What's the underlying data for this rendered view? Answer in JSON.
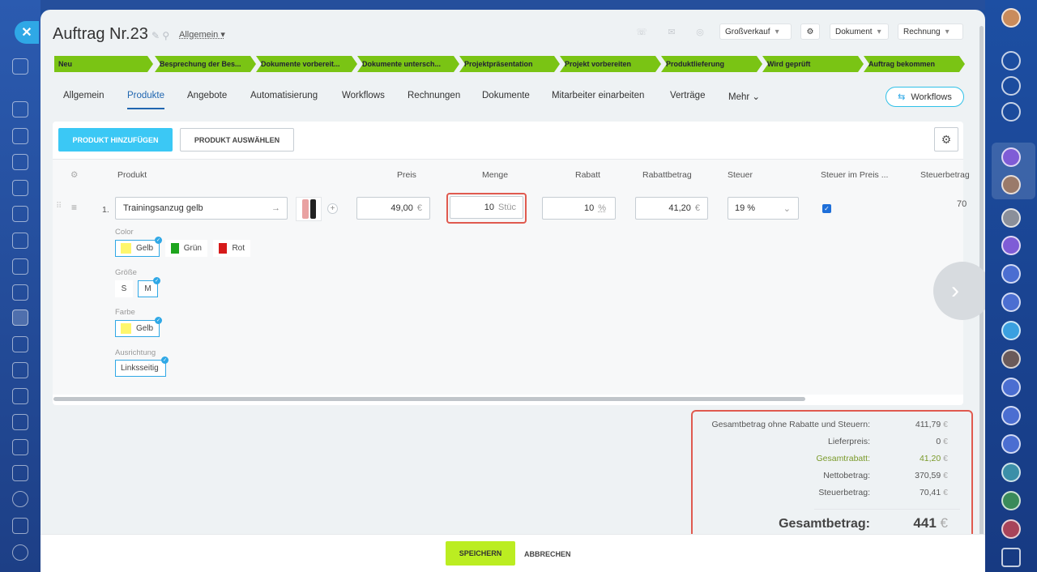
{
  "order": {
    "title": "Auftrag Nr.23",
    "category": "Allgemein"
  },
  "header": {
    "segment": "Großverkauf",
    "document": "Dokument",
    "invoice": "Rechnung"
  },
  "stages": [
    "Neu",
    "Besprechung der Bes...",
    "Dokumente vorbereit...",
    "Dokumente untersch...",
    "Projektpräsentation",
    "Projekt vorbereiten",
    "Produktlieferung",
    "Wird geprüft",
    "Auftrag bekommen"
  ],
  "tabs": [
    "Allgemein",
    "Produkte",
    "Angebote",
    "Automatisierung",
    "Workflows",
    "Rechnungen",
    "Dokumente",
    "Mitarbeiter einarbeiten",
    "Verträge",
    "Mehr"
  ],
  "workflows_button": "Workflows",
  "actions": {
    "add_product": "PRODUKT HINZUFÜGEN",
    "select_product": "PRODUKT AUSWÄHLEN"
  },
  "columns": [
    "Produkt",
    "Preis",
    "Menge",
    "Rabatt",
    "Rabattbetrag",
    "Steuer",
    "Steuer im Preis ...",
    "Steuerbetrag"
  ],
  "product": {
    "index": "1.",
    "name": "Trainingsanzug gelb",
    "price": "49,00",
    "currency": "€",
    "quantity": "10",
    "quantity_unit": "Stüc",
    "discount": "10",
    "discount_unit": "%",
    "discount_amount": "41,20",
    "tax": "19 %",
    "tax_amount": "70"
  },
  "variants": {
    "color": {
      "label": "Color",
      "options": [
        "Gelb",
        "Grün",
        "Rot"
      ],
      "colors": [
        "#fef66d",
        "#1ea51e",
        "#d61a1a"
      ]
    },
    "size": {
      "label": "Größe",
      "options": [
        "S",
        "M"
      ]
    },
    "farbe": {
      "label": "Farbe",
      "options": [
        "Gelb"
      ],
      "colors": [
        "#fef66d"
      ]
    },
    "orientation": {
      "label": "Ausrichtung",
      "options": [
        "Linksseitig"
      ]
    }
  },
  "summary": {
    "gross_label": "Gesamtbetrag ohne Rabatte und Steuern:",
    "gross": "411,79",
    "delivery_label": "Lieferpreis:",
    "delivery": "0",
    "discount_label": "Gesamtrabatt:",
    "discount": "41,20",
    "net_label": "Nettobetrag:",
    "net": "370,59",
    "tax_label": "Steuerbetrag:",
    "tax": "70,41",
    "total_label": "Gesamtbetrag:",
    "total": "441",
    "currency": "€",
    "discount_color": "#7a9a2a"
  },
  "footer": {
    "save": "SPEICHERN",
    "cancel": "ABBRECHEN"
  },
  "colors": {
    "accent": "#3bc8f5",
    "stage": "#7ac414",
    "save": "#bbed21",
    "highlight": "#e05a4f"
  }
}
